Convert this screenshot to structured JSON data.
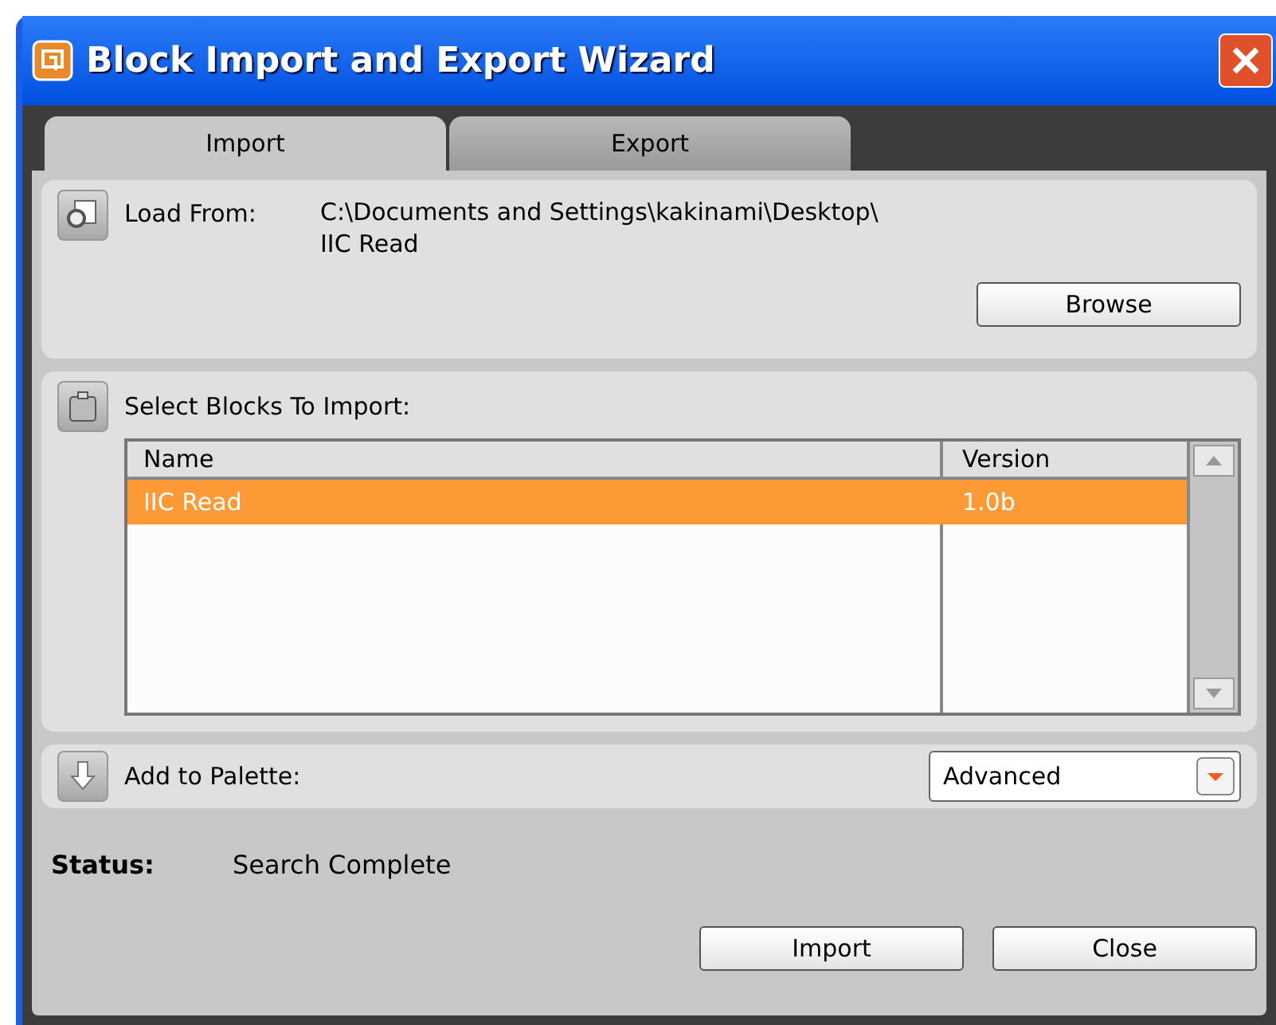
{
  "window": {
    "title": "Block Import and Export Wizard"
  },
  "tabs": [
    {
      "label": "Import",
      "selected": true
    },
    {
      "label": "Export",
      "selected": false
    }
  ],
  "load_from": {
    "label": "Load From:",
    "path_lines": [
      "C:\\Documents and Settings\\kakinami\\Desktop\\",
      "IIC Read"
    ],
    "button": "Browse"
  },
  "select_blocks": {
    "label": "Select Blocks To Import:",
    "columns": [
      "Name",
      "Version"
    ],
    "rows": [
      {
        "cells": [
          "IIC Read",
          "1.0b"
        ],
        "selected": true
      }
    ]
  },
  "palette": {
    "label": "Add to Palette:",
    "value": "Advanced"
  },
  "status": {
    "label": "Status:",
    "value": "Search Complete"
  },
  "buttons": [
    "Import",
    "Close"
  ]
}
